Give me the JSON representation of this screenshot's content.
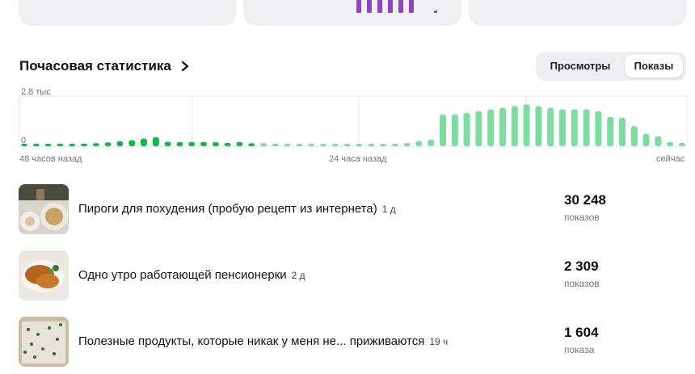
{
  "section": {
    "title": "Почасовая статистика"
  },
  "toggle": {
    "options": [
      "Просмотры",
      "Показы"
    ],
    "active": "Показы"
  },
  "chart_data": {
    "type": "bar",
    "ymax_label": "2.8 тыс",
    "ymin_label": "0",
    "ylim": [
      0,
      2800
    ],
    "xlabels": {
      "start": "48 часов назад",
      "middle": "24 часа назад",
      "end": "сейчас"
    },
    "colors": {
      "older": "#12b84a",
      "recent": "#7edca0"
    },
    "series": [
      {
        "period": "older",
        "values": [
          60,
          70,
          80,
          100,
          130,
          160,
          180,
          230,
          300,
          360,
          460,
          540,
          270,
          250,
          250,
          250,
          250,
          200,
          250,
          180
        ]
      },
      {
        "period": "recent",
        "values": [
          180,
          160,
          140,
          120,
          110,
          100,
          100,
          100,
          100,
          100,
          100,
          110,
          190,
          320,
          400,
          1900,
          1900,
          2000,
          2100,
          2200,
          2300,
          2400,
          2500,
          2400,
          2300,
          2200,
          2200,
          2200,
          2100,
          1750,
          1700,
          1200,
          750,
          600,
          250,
          200
        ]
      }
    ]
  },
  "posts": [
    {
      "title": "Пироги для похудения (пробую рецепт из интернета)",
      "age": "1 д",
      "count": "30 248",
      "unit": "показов"
    },
    {
      "title": "Одно утро работающей пенсионерки",
      "age": "2 д",
      "count": "2 309",
      "unit": "показов"
    },
    {
      "title": "Полезные продукты, которые никак у меня не... приживаются",
      "age": "19 ч",
      "count": "1 604",
      "unit": "показа"
    }
  ]
}
